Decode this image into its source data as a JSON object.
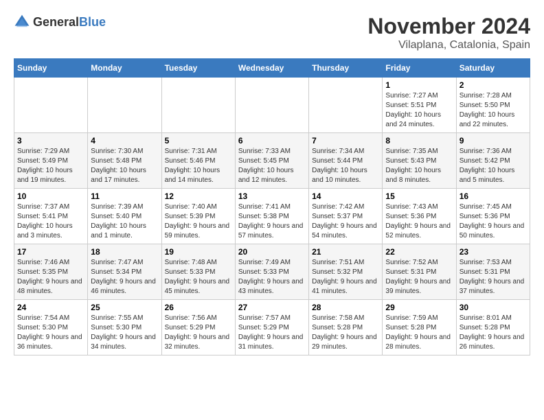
{
  "header": {
    "logo_general": "General",
    "logo_blue": "Blue",
    "month_title": "November 2024",
    "location": "Vilaplana, Catalonia, Spain"
  },
  "days_of_week": [
    "Sunday",
    "Monday",
    "Tuesday",
    "Wednesday",
    "Thursday",
    "Friday",
    "Saturday"
  ],
  "weeks": [
    [
      {
        "day": "",
        "info": ""
      },
      {
        "day": "",
        "info": ""
      },
      {
        "day": "",
        "info": ""
      },
      {
        "day": "",
        "info": ""
      },
      {
        "day": "",
        "info": ""
      },
      {
        "day": "1",
        "info": "Sunrise: 7:27 AM\nSunset: 5:51 PM\nDaylight: 10 hours and 24 minutes."
      },
      {
        "day": "2",
        "info": "Sunrise: 7:28 AM\nSunset: 5:50 PM\nDaylight: 10 hours and 22 minutes."
      }
    ],
    [
      {
        "day": "3",
        "info": "Sunrise: 7:29 AM\nSunset: 5:49 PM\nDaylight: 10 hours and 19 minutes."
      },
      {
        "day": "4",
        "info": "Sunrise: 7:30 AM\nSunset: 5:48 PM\nDaylight: 10 hours and 17 minutes."
      },
      {
        "day": "5",
        "info": "Sunrise: 7:31 AM\nSunset: 5:46 PM\nDaylight: 10 hours and 14 minutes."
      },
      {
        "day": "6",
        "info": "Sunrise: 7:33 AM\nSunset: 5:45 PM\nDaylight: 10 hours and 12 minutes."
      },
      {
        "day": "7",
        "info": "Sunrise: 7:34 AM\nSunset: 5:44 PM\nDaylight: 10 hours and 10 minutes."
      },
      {
        "day": "8",
        "info": "Sunrise: 7:35 AM\nSunset: 5:43 PM\nDaylight: 10 hours and 8 minutes."
      },
      {
        "day": "9",
        "info": "Sunrise: 7:36 AM\nSunset: 5:42 PM\nDaylight: 10 hours and 5 minutes."
      }
    ],
    [
      {
        "day": "10",
        "info": "Sunrise: 7:37 AM\nSunset: 5:41 PM\nDaylight: 10 hours and 3 minutes."
      },
      {
        "day": "11",
        "info": "Sunrise: 7:39 AM\nSunset: 5:40 PM\nDaylight: 10 hours and 1 minute."
      },
      {
        "day": "12",
        "info": "Sunrise: 7:40 AM\nSunset: 5:39 PM\nDaylight: 9 hours and 59 minutes."
      },
      {
        "day": "13",
        "info": "Sunrise: 7:41 AM\nSunset: 5:38 PM\nDaylight: 9 hours and 57 minutes."
      },
      {
        "day": "14",
        "info": "Sunrise: 7:42 AM\nSunset: 5:37 PM\nDaylight: 9 hours and 54 minutes."
      },
      {
        "day": "15",
        "info": "Sunrise: 7:43 AM\nSunset: 5:36 PM\nDaylight: 9 hours and 52 minutes."
      },
      {
        "day": "16",
        "info": "Sunrise: 7:45 AM\nSunset: 5:36 PM\nDaylight: 9 hours and 50 minutes."
      }
    ],
    [
      {
        "day": "17",
        "info": "Sunrise: 7:46 AM\nSunset: 5:35 PM\nDaylight: 9 hours and 48 minutes."
      },
      {
        "day": "18",
        "info": "Sunrise: 7:47 AM\nSunset: 5:34 PM\nDaylight: 9 hours and 46 minutes."
      },
      {
        "day": "19",
        "info": "Sunrise: 7:48 AM\nSunset: 5:33 PM\nDaylight: 9 hours and 45 minutes."
      },
      {
        "day": "20",
        "info": "Sunrise: 7:49 AM\nSunset: 5:33 PM\nDaylight: 9 hours and 43 minutes."
      },
      {
        "day": "21",
        "info": "Sunrise: 7:51 AM\nSunset: 5:32 PM\nDaylight: 9 hours and 41 minutes."
      },
      {
        "day": "22",
        "info": "Sunrise: 7:52 AM\nSunset: 5:31 PM\nDaylight: 9 hours and 39 minutes."
      },
      {
        "day": "23",
        "info": "Sunrise: 7:53 AM\nSunset: 5:31 PM\nDaylight: 9 hours and 37 minutes."
      }
    ],
    [
      {
        "day": "24",
        "info": "Sunrise: 7:54 AM\nSunset: 5:30 PM\nDaylight: 9 hours and 36 minutes."
      },
      {
        "day": "25",
        "info": "Sunrise: 7:55 AM\nSunset: 5:30 PM\nDaylight: 9 hours and 34 minutes."
      },
      {
        "day": "26",
        "info": "Sunrise: 7:56 AM\nSunset: 5:29 PM\nDaylight: 9 hours and 32 minutes."
      },
      {
        "day": "27",
        "info": "Sunrise: 7:57 AM\nSunset: 5:29 PM\nDaylight: 9 hours and 31 minutes."
      },
      {
        "day": "28",
        "info": "Sunrise: 7:58 AM\nSunset: 5:28 PM\nDaylight: 9 hours and 29 minutes."
      },
      {
        "day": "29",
        "info": "Sunrise: 7:59 AM\nSunset: 5:28 PM\nDaylight: 9 hours and 28 minutes."
      },
      {
        "day": "30",
        "info": "Sunrise: 8:01 AM\nSunset: 5:28 PM\nDaylight: 9 hours and 26 minutes."
      }
    ]
  ]
}
